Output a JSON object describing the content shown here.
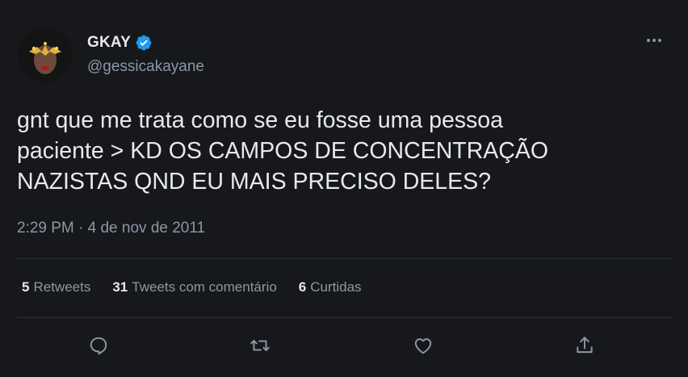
{
  "user": {
    "display_name": "GKAY",
    "handle": "@gessicakayane",
    "avatar_icon": "profile-avatar",
    "verified_icon": "verified-badge-icon",
    "verified_color": "#1d9bf0"
  },
  "tweet": {
    "text": "gnt que me trata como se eu fosse uma pessoa\npaciente > KD OS CAMPOS DE CONCENTRAÇÃO\nNAZISTAS QND EU MAIS PRECISO DELES?",
    "timestamp": "2:29 PM · 4 de nov de 2011"
  },
  "stats": [
    {
      "count": "5",
      "label": "Retweets"
    },
    {
      "count": "31",
      "label": "Tweets com comentário"
    },
    {
      "count": "6",
      "label": "Curtidas"
    }
  ],
  "actions": [
    {
      "icon": "reply-icon"
    },
    {
      "icon": "retweet-icon"
    },
    {
      "icon": "like-icon"
    },
    {
      "icon": "share-icon"
    }
  ],
  "colors": {
    "background": "#16181c",
    "primary_text": "#e7e9ea",
    "secondary_text": "#8b98a5",
    "divider": "#2f3336"
  }
}
